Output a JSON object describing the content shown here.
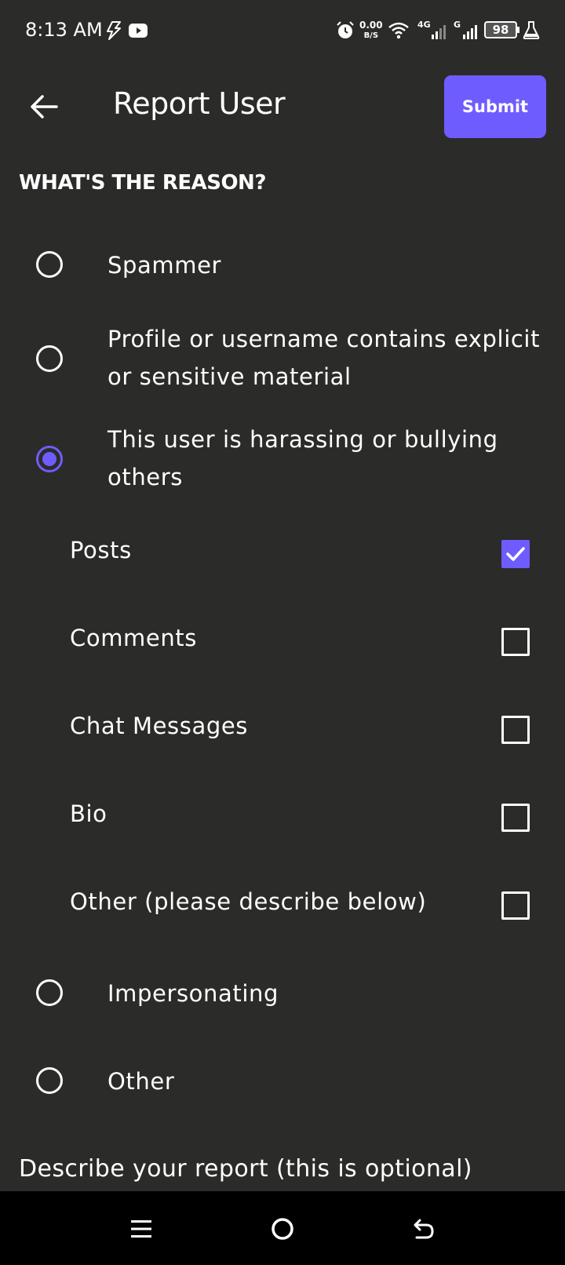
{
  "status_bar": {
    "time": "8:13 AM",
    "speed_value": "0.00",
    "speed_unit": "B/S",
    "network_primary": "4G",
    "network_secondary": "G",
    "battery": "98",
    "icons": [
      "flash-icon",
      "youtube-icon",
      "alarm-icon",
      "wifi-icon",
      "signal-icon",
      "battery-icon",
      "lab-icon"
    ]
  },
  "app_bar": {
    "title": "Report User",
    "submit_label": "Submit",
    "back_icon": "arrow-left-icon"
  },
  "section_title": "WHAT'S THE REASON?",
  "reasons": [
    {
      "label": "Spammer",
      "selected": false
    },
    {
      "label": "Profile or username contains explicit or sensitive material",
      "selected": false
    },
    {
      "label": "This user is harassing or bullying others",
      "selected": true
    },
    {
      "label": "Impersonating",
      "selected": false
    },
    {
      "label": "Other",
      "selected": false
    }
  ],
  "harassment_targets": [
    {
      "label": "Posts",
      "checked": true
    },
    {
      "label": "Comments",
      "checked": false
    },
    {
      "label": "Chat Messages",
      "checked": false
    },
    {
      "label": "Bio",
      "checked": false
    },
    {
      "label": "Other (please describe below)",
      "checked": false
    }
  ],
  "describe_label": "Describe your report (this is optional)",
  "nav_bar": {
    "icons": [
      "menu-icon",
      "home-icon",
      "back-icon"
    ]
  },
  "colors": {
    "background": "#2b2b29",
    "accent": "#6f5cff",
    "nav_background": "#000000"
  }
}
